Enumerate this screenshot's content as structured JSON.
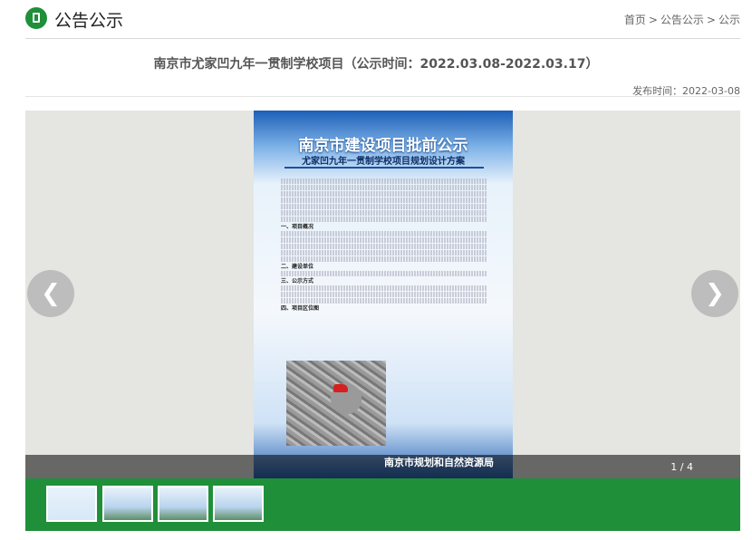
{
  "header": {
    "title": "公告公示",
    "breadcrumb": [
      "首页",
      "公告公示",
      "公示"
    ],
    "separator": ">"
  },
  "article": {
    "title": "南京市尤家凹九年一贯制学校项目（公示时间：2022.03.08-2022.03.17）",
    "publish_time": "发布时间：2022-03-08"
  },
  "viewer": {
    "slide": {
      "title": "南京市建设项目批前公示",
      "subtitle": "尤家凹九年一贯制学校项目规划设计方案",
      "sections": [
        "一、项目概况",
        "二、建设单位",
        "三、公示方式",
        "四、项目区位图"
      ],
      "footer_org": "南京市规划和自然资源局"
    },
    "prev_icon": "chevron-left-icon",
    "next_icon": "chevron-right-icon",
    "counter": "1 / 4",
    "thumbnail_count": 4,
    "active_thumbnail": 1
  },
  "colors": {
    "brand_green": "#1f8f3a",
    "slide_blue": "#1d5fb8"
  }
}
